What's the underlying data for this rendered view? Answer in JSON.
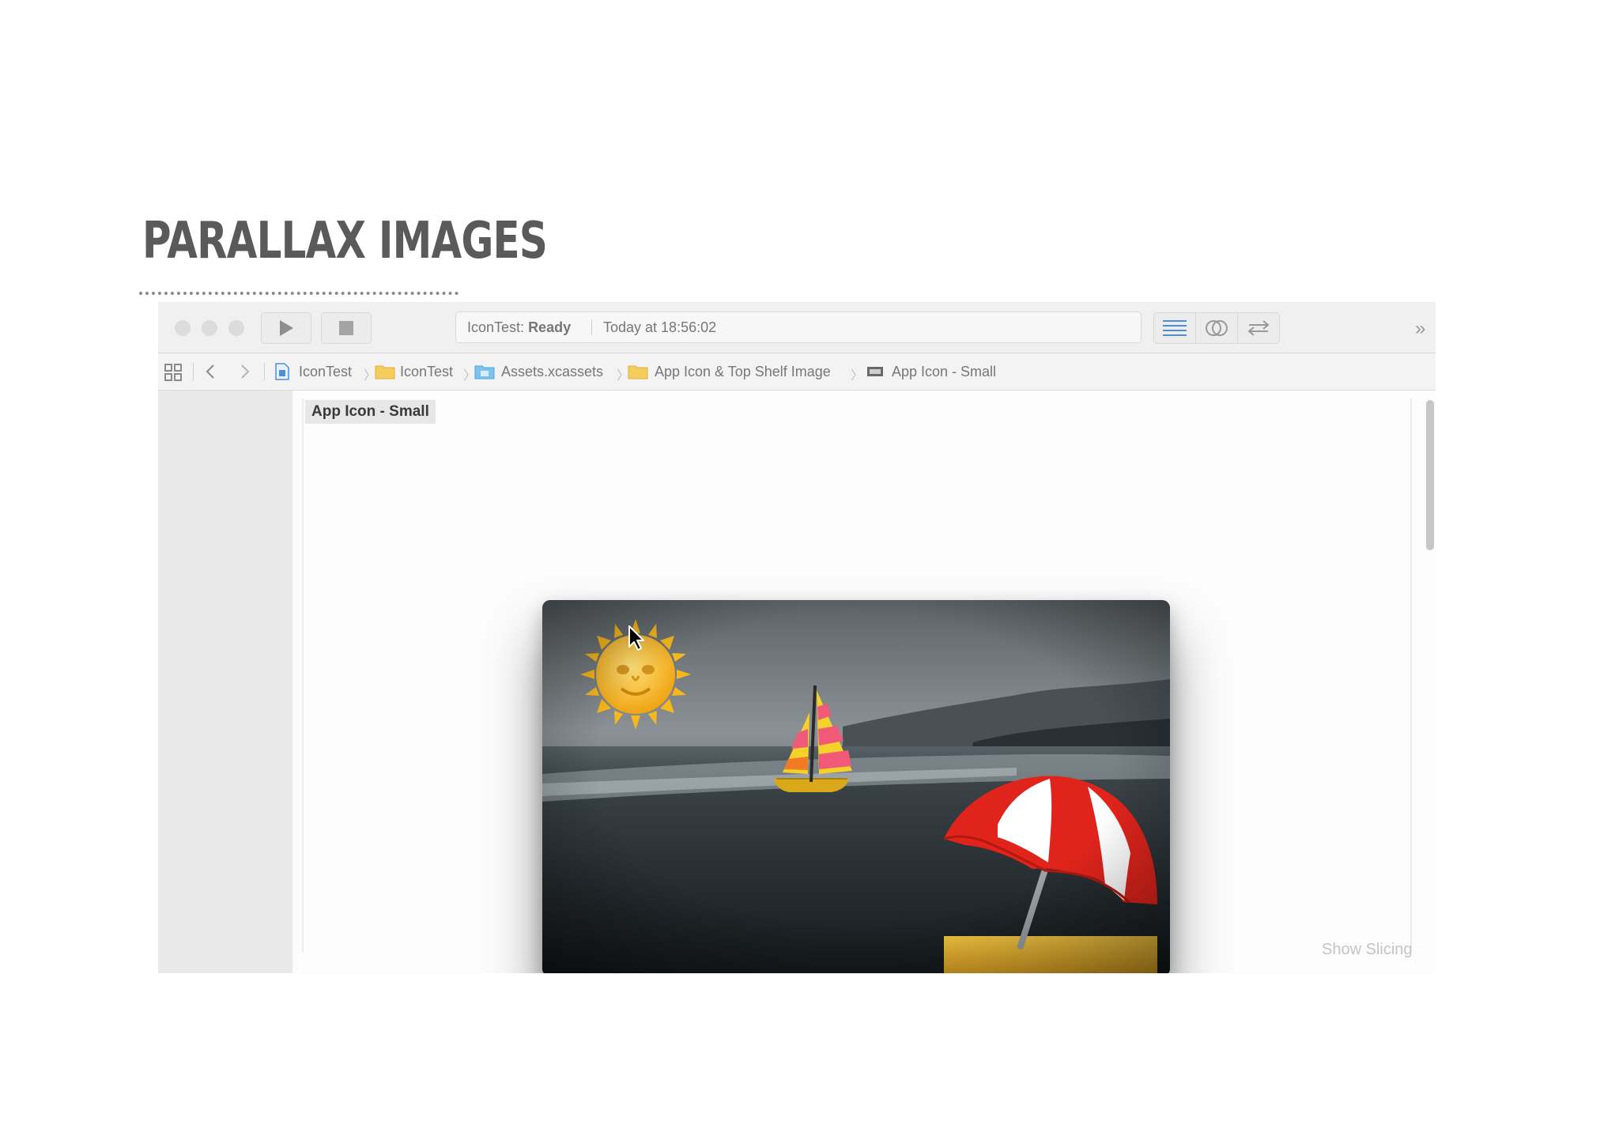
{
  "slide": {
    "title": "PARALLAX IMAGES"
  },
  "toolbar": {
    "scheme": "IconTest:",
    "state": "Ready",
    "time": "Today at 18:56:02",
    "overflow": "»"
  },
  "jumpbar": {
    "crumbs": [
      {
        "label": "IconTest",
        "icon": "project-file-icon"
      },
      {
        "label": "IconTest",
        "icon": "folder-icon"
      },
      {
        "label": "Assets.xcassets",
        "icon": "asset-catalog-icon"
      },
      {
        "label": "App Icon & Top Shelf Image",
        "icon": "folder-icon"
      },
      {
        "label": "App Icon - Small",
        "icon": "image-stack-icon"
      }
    ]
  },
  "editor": {
    "asset_label": "App Icon - Small",
    "show_slicing": "Show Slicing"
  },
  "colors": {
    "accent": "#4a90d9",
    "folder": "#f4cd5d",
    "asset_folder": "#7cc3ef",
    "umbrella_red": "#e0241b",
    "sand": "#f0b92d"
  }
}
